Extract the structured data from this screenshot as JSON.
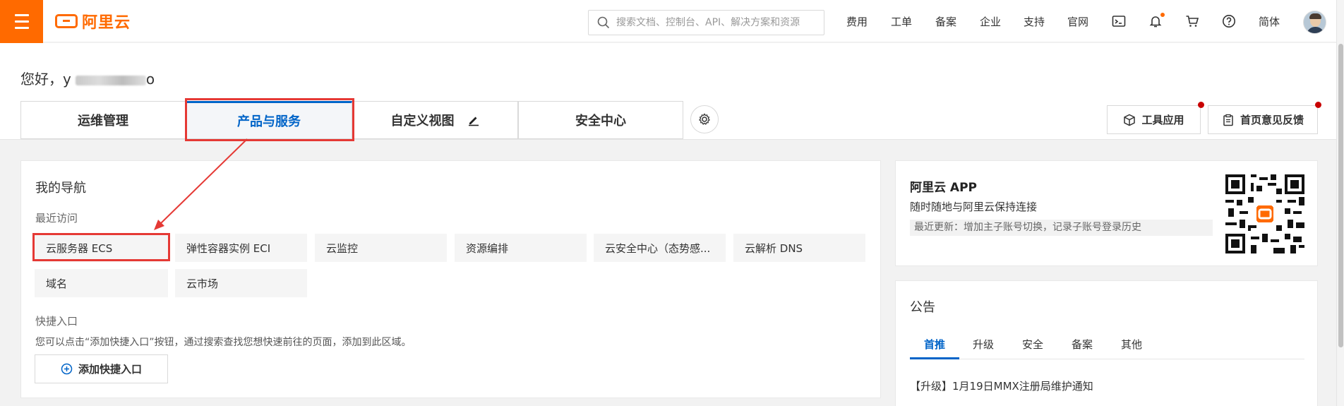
{
  "topbar": {
    "logo_text": "阿里云",
    "search_placeholder": "搜索文档、控制台、API、解决方案和资源",
    "links": [
      "费用",
      "工单",
      "备案",
      "企业",
      "支持",
      "官网"
    ],
    "language": "简体",
    "icons": [
      "menu-icon",
      "search-icon",
      "terminal-icon",
      "bell-icon",
      "cart-icon",
      "help-icon"
    ]
  },
  "greeting": {
    "prefix": "您好，",
    "name_visible": "y",
    "name_tail": "o"
  },
  "tabs": [
    {
      "label": "运维管理"
    },
    {
      "label": "产品与服务",
      "active": true
    },
    {
      "label": "自定义视图"
    },
    {
      "label": "安全中心"
    }
  ],
  "toolbar": {
    "tools_label": "工具应用",
    "feedback_label": "首页意见反馈"
  },
  "my_nav": {
    "title": "我的导航",
    "recent_label": "最近访问",
    "recent_items": [
      "云服务器 ECS",
      "弹性容器实例 ECI",
      "云监控",
      "资源编排",
      "云安全中心（态势感...",
      "云解析 DNS",
      "域名",
      "云市场"
    ],
    "quick_label": "快捷入口",
    "quick_hint": "您可以点击“添加快捷入口”按钮，通过搜索查找您想快速前往的页面，添加到此区域。",
    "add_button": "添加快捷入口"
  },
  "app_card": {
    "title": "阿里云 APP",
    "subtitle": "随时随地与阿里云保持连接",
    "update": "最近更新：增加主子账号切换，记录子账号登录历史"
  },
  "notice": {
    "title": "公告",
    "tabs": [
      "首推",
      "升级",
      "安全",
      "备案",
      "其他"
    ],
    "active_tab": "首推",
    "items": [
      "【升级】1月19日MMX注册局维护通知"
    ]
  },
  "colors": {
    "brand_orange": "#ff6a00",
    "active_blue": "#0064c8",
    "annotation_red": "#e53935"
  }
}
